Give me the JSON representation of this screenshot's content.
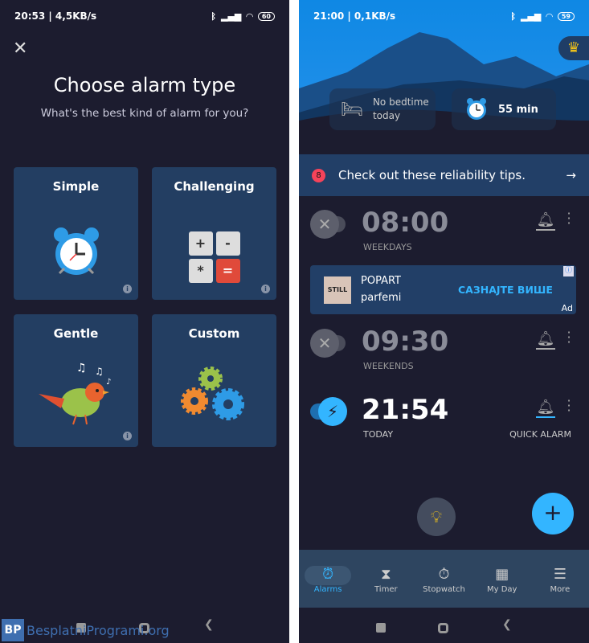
{
  "left": {
    "status": {
      "text": "20:53 | 4,5KB/s",
      "battery": "60"
    },
    "title": "Choose alarm type",
    "subtitle": "What's the best kind of alarm for you?",
    "cards": [
      {
        "label": "Simple",
        "icon": "alarm-clock-icon"
      },
      {
        "label": "Challenging",
        "icon": "calculator-icon",
        "keys": [
          "+",
          "-",
          "*",
          "="
        ]
      },
      {
        "label": "Gentle",
        "icon": "bird-icon"
      },
      {
        "label": "Custom",
        "icon": "gears-icon"
      }
    ],
    "info": "i",
    "watermark": "BesplatniProgrami.org"
  },
  "right": {
    "status": {
      "text": "21:00 | 0,1KB/s",
      "battery": "59"
    },
    "bedtime": "No bedtime today",
    "bedtime_l1": "No bedtime",
    "bedtime_l2": "today",
    "next_alarm": "55 min",
    "tips": {
      "count": "8",
      "text": "Check out these reliability tips.",
      "arrow": "→"
    },
    "alarms": [
      {
        "time": "08:00",
        "days": "WEEKDAYS",
        "enabled": false
      },
      {
        "time": "09:30",
        "days": "WEEKENDS",
        "enabled": false
      },
      {
        "time": "21:54",
        "days": "TODAY",
        "label": "QUICK ALARM",
        "enabled": true
      }
    ],
    "ad": {
      "logo": "STILL",
      "title": "POPART",
      "subtitle": "parfemi",
      "cta": "САЗНАЈТЕ ВИШЕ",
      "tag": "Ad"
    },
    "fab": "+",
    "nav": [
      {
        "label": "Alarms",
        "icon": "alarm-icon",
        "active": true
      },
      {
        "label": "Timer",
        "icon": "hourglass-icon"
      },
      {
        "label": "Stopwatch",
        "icon": "stopwatch-icon"
      },
      {
        "label": "My Day",
        "icon": "calendar-icon"
      },
      {
        "label": "More",
        "icon": "menu-icon"
      }
    ],
    "accent": "#33b5ff"
  }
}
